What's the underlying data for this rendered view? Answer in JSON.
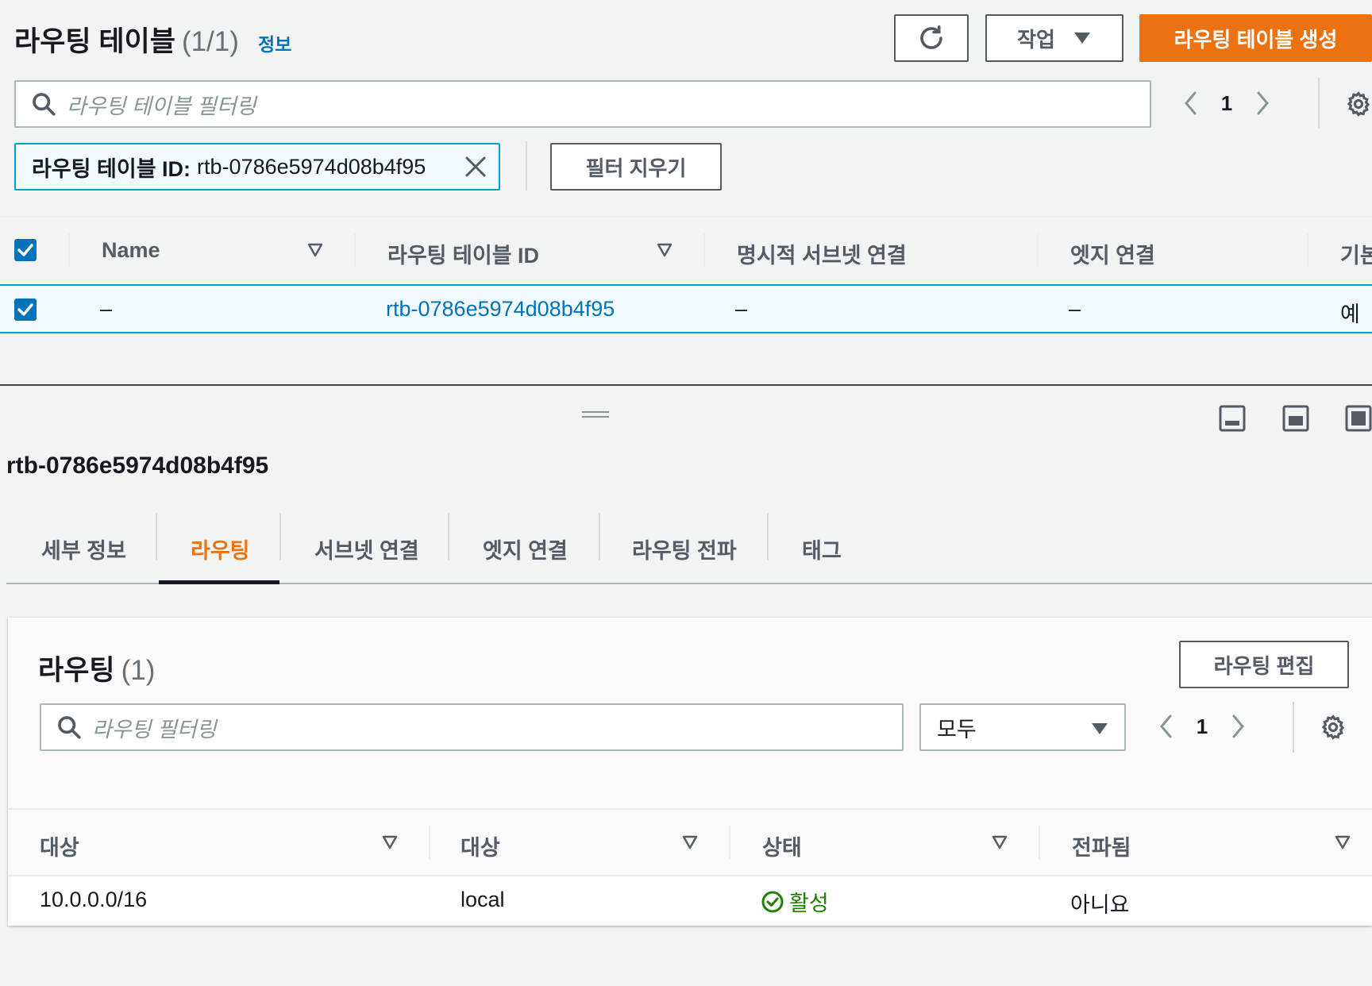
{
  "header": {
    "title": "라우팅 테이블",
    "count": "(1/1)",
    "info_link": "정보",
    "actions_label": "작업",
    "create_label": "라우팅 테이블 생성",
    "refresh_icon": "refresh-icon"
  },
  "search": {
    "placeholder": "라우팅 테이블 필터링"
  },
  "pagination": {
    "page": "1"
  },
  "filter_token": {
    "key": "라우팅 테이블 ID:",
    "value": "rtb-0786e5974d08b4f95"
  },
  "clear_filters_label": "필터 지우기",
  "table": {
    "columns": [
      "Name",
      "라우팅 테이블 ID",
      "명시적 서브넷 연결",
      "엣지 연결",
      "기본"
    ],
    "rows": [
      {
        "name": "–",
        "route_table_id": "rtb-0786e5974d08b4f95",
        "explicit_subnet": "–",
        "edge": "–",
        "main": "예"
      }
    ]
  },
  "detail": {
    "title": "rtb-0786e5974d08b4f95",
    "tabs": [
      "세부 정보",
      "라우팅",
      "서브넷 연결",
      "엣지 연결",
      "라우팅 전파",
      "태그"
    ],
    "active_tab": "라우팅"
  },
  "routes": {
    "title": "라우팅",
    "count": "(1)",
    "edit_label": "라우팅 편집",
    "search_placeholder": "라우팅 필터링",
    "select_value": "모두",
    "page": "1",
    "columns": [
      "대상",
      "대상",
      "상태",
      "전파됨"
    ],
    "rows": [
      {
        "destination": "10.0.0.0/16",
        "target": "local",
        "status": "활성",
        "propagated": "아니요"
      }
    ]
  },
  "colors": {
    "primary": "#ec7211",
    "link": "#0073bb",
    "success": "#1d8102",
    "selected_bg": "#f1faff"
  }
}
